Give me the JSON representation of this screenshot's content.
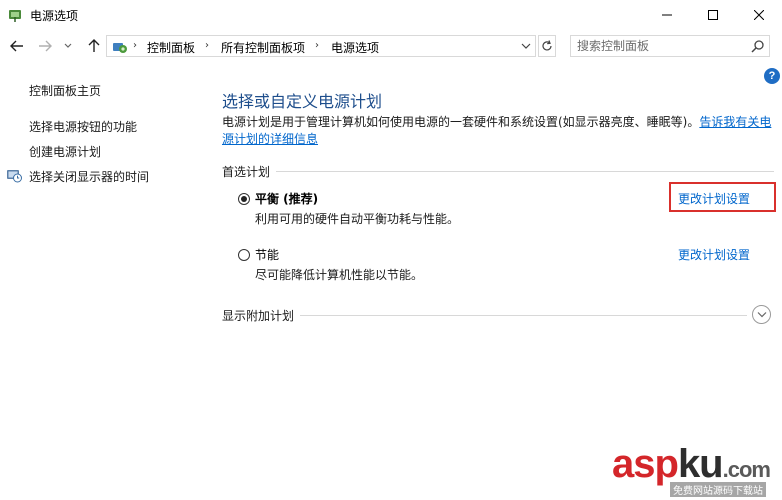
{
  "window": {
    "title": "电源选项",
    "minimize_glyph": "─",
    "maximize_glyph": "☐",
    "close_glyph": "✕"
  },
  "nav": {
    "back_glyph": "←",
    "forward_glyph": "→",
    "recent_glyph": "⌄",
    "up_glyph": "↑",
    "breadcrumb": [
      "控制面板",
      "所有控制面板项",
      "电源选项"
    ],
    "breadcrumb_separator": "›",
    "refresh_glyph": "↻",
    "search_placeholder": "搜索控制面板"
  },
  "help": {
    "glyph": "?"
  },
  "sidebar": {
    "home": "控制面板主页",
    "items": [
      {
        "label": "选择电源按钮的功能"
      },
      {
        "label": "创建电源计划"
      },
      {
        "label": "选择关闭显示器的时间"
      }
    ]
  },
  "main": {
    "heading": "选择或自定义电源计划",
    "description": "电源计划是用于管理计算机如何使用电源的一套硬件和系统设置(如显示器亮度、睡眠等)。",
    "description_link": "告诉我有关电源计划的详细信息",
    "preferred_section": "首选计划",
    "plans": [
      {
        "name": "平衡 (推荐)",
        "desc": "利用可用的硬件自动平衡功耗与性能。",
        "selected": true,
        "link": "更改计划设置"
      },
      {
        "name": "节能",
        "desc": "尽可能降低计算机性能以节能。",
        "selected": false,
        "link": "更改计划设置"
      }
    ],
    "additional_section": "显示附加计划"
  },
  "watermark": {
    "logo_a": "asp",
    "logo_b": "ku",
    "logo_c": ".com",
    "subtitle": "免费网站源码下载站"
  },
  "colors": {
    "heading": "#1e4e8c",
    "link": "#0066cc",
    "highlight": "#d9302c",
    "help": "#1f6dc4"
  }
}
